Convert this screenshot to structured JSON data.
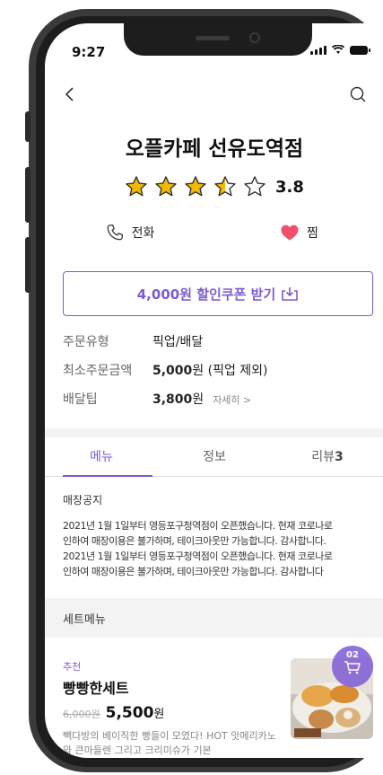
{
  "status": {
    "time": "9:27"
  },
  "store": {
    "name": "오플카페 선유도역점",
    "rating": 3.8,
    "rating_text": "3.8"
  },
  "actions": {
    "call_label": "전화",
    "favorite_label": "찜"
  },
  "coupon": {
    "label": "4,000원 할인쿠폰 받기"
  },
  "info": {
    "rows": [
      {
        "label": "주문유형",
        "value": "픽업/배달"
      },
      {
        "label": "최소주문금액",
        "value_bold": "5,000",
        "value": "원 (픽업 제외)"
      },
      {
        "label": "배달팁",
        "value_bold": "3,800",
        "value": "원",
        "link": "자세히 >"
      }
    ]
  },
  "tabs": [
    {
      "label": "메뉴"
    },
    {
      "label": "정보"
    },
    {
      "label": "리뷰",
      "count": "3"
    }
  ],
  "notice": {
    "title": "매장공지",
    "lines": [
      "2021년 1월 1일부터 영등포구청역점이 오픈했습니다. 현재 코로나로",
      "인하여 매장이용은 불가하며, 테이크아웃만 가능합니다. 감사합니다.",
      "2021년 1월 1일부터 영등포구청역점이 오픈했습니다. 현재 코로나로",
      "인하여 매장이용은 불가하며, 테이크아웃만 가능합니다. 감사합니다"
    ]
  },
  "section": {
    "title": "세트메뉴"
  },
  "menu": {
    "tag": "추천",
    "name": "빵빵한세트",
    "old_price": "6,000원",
    "price_number": "5,500",
    "price_unit": "원",
    "description": "빽다방의 베이직한 빵들이 모였다! HOT 앗메리카노와 큰마들렌 그리고 크리미슈가 기본"
  },
  "cart": {
    "count": "02"
  },
  "colors": {
    "accent": "#7c5bd6",
    "star": "#f5b800",
    "heart": "#f0506e"
  },
  "icons": [
    "back-arrow-icon",
    "search-icon",
    "star-icon",
    "phone-icon",
    "heart-icon",
    "download-icon",
    "cart-icon"
  ]
}
